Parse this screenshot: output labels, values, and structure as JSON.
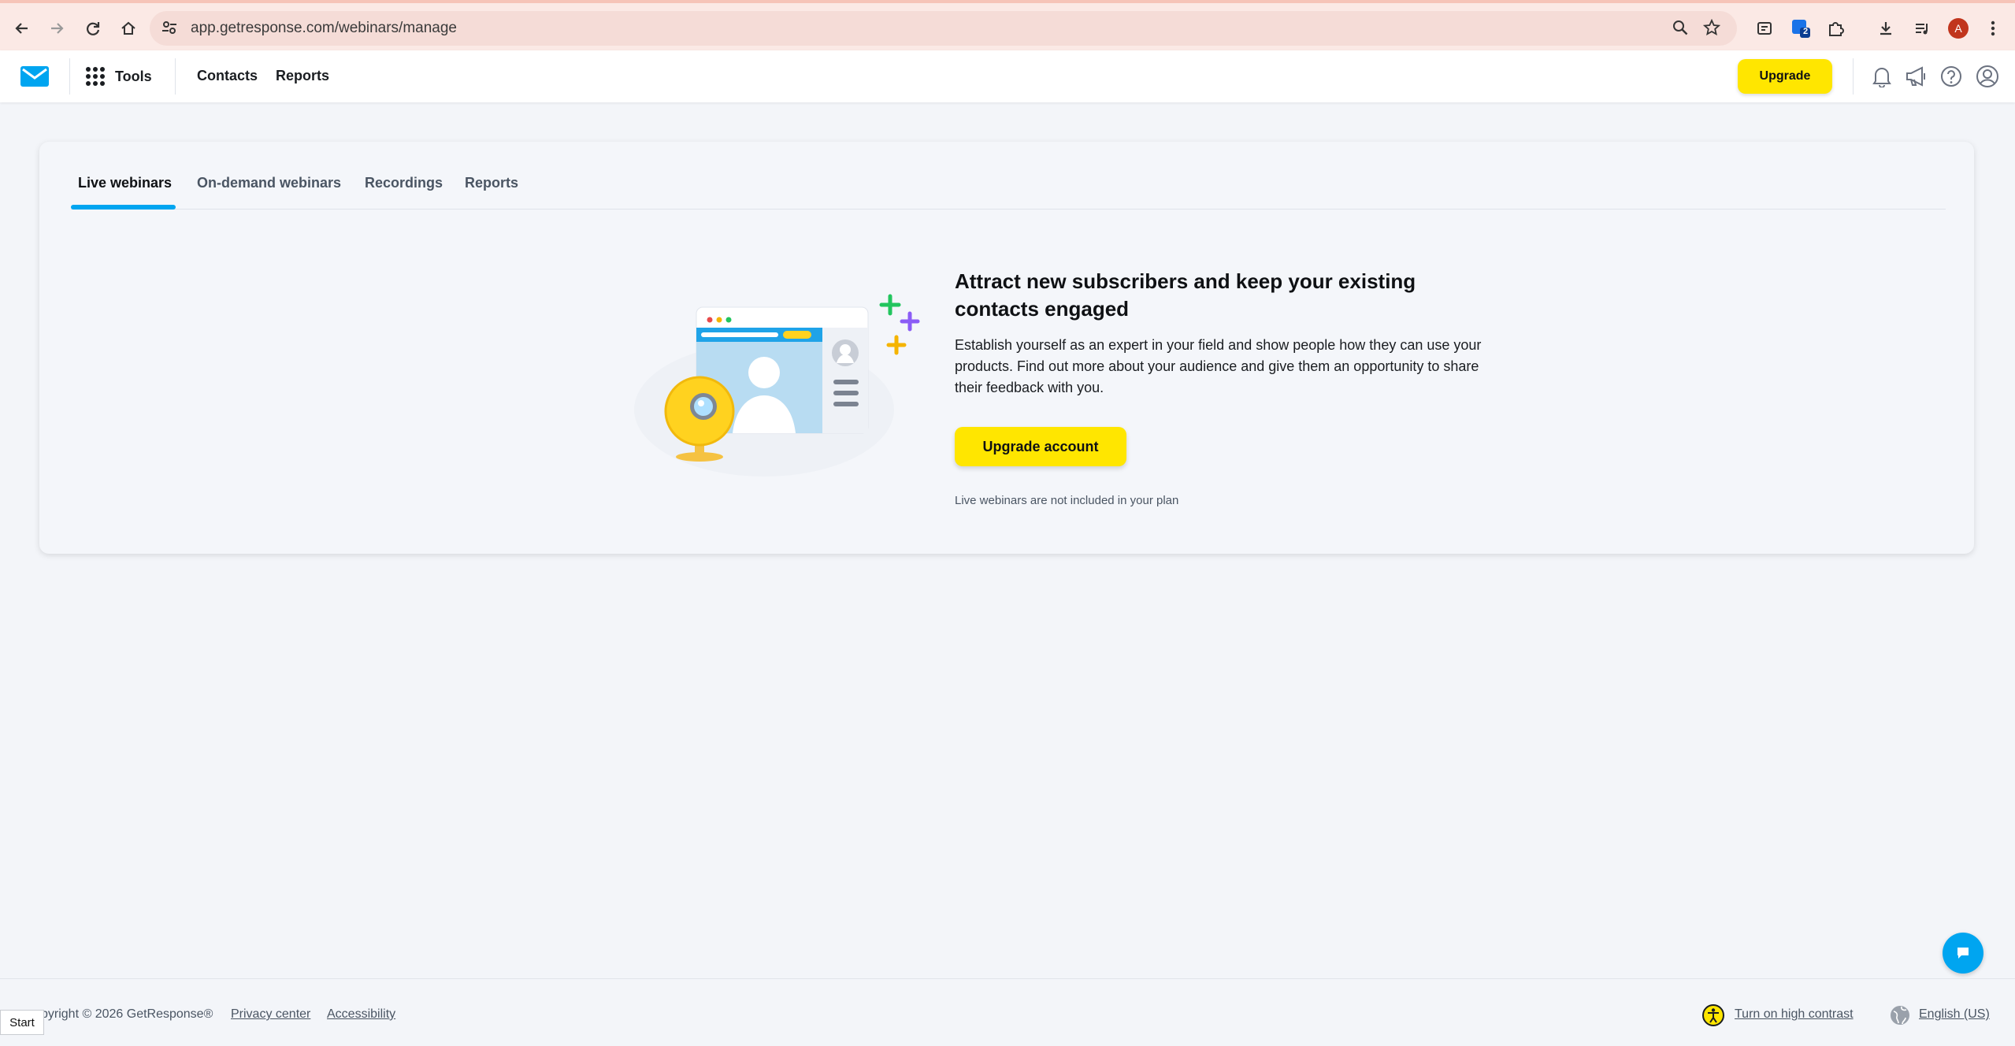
{
  "browser": {
    "url": "app.getresponse.com/webinars/manage",
    "profile_initial": "A",
    "extension_badge": "2"
  },
  "header": {
    "tools_label": "Tools",
    "nav": [
      "Contacts",
      "Reports"
    ],
    "upgrade_label": "Upgrade"
  },
  "tabs": [
    "Live webinars",
    "On-demand webinars",
    "Recordings",
    "Reports"
  ],
  "promo": {
    "headline": "Attract new subscribers and keep your existing contacts engaged",
    "description": "Establish yourself as an expert in your field and show people how they can use your products. Find out more about your audience and give them an opportunity to share their feedback with you.",
    "button_label": "Upgrade account",
    "note": "Live webinars are not included in your plan"
  },
  "footer": {
    "copyright": "pyright © 2026 GetResponse®",
    "privacy": "Privacy center",
    "accessibility": "Accessibility",
    "contrast": "Turn on high contrast",
    "language": "English (US)"
  },
  "taskbar": {
    "start": "Start"
  },
  "colors": {
    "accent_yellow": "#ffe600",
    "brand_blue": "#00a5f0",
    "background": "#f3f5f9"
  }
}
